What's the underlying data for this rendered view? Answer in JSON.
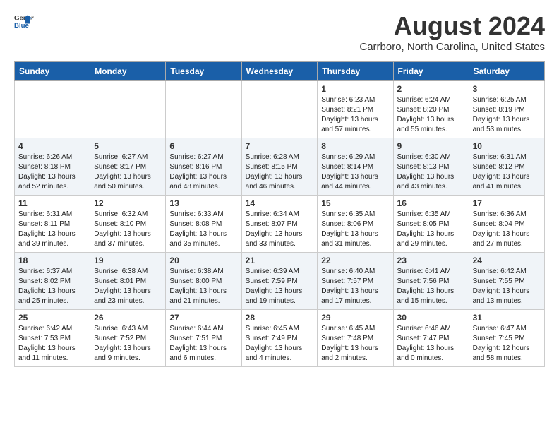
{
  "header": {
    "logo_line1": "General",
    "logo_line2": "Blue",
    "title": "August 2024",
    "subtitle": "Carrboro, North Carolina, United States"
  },
  "weekdays": [
    "Sunday",
    "Monday",
    "Tuesday",
    "Wednesday",
    "Thursday",
    "Friday",
    "Saturday"
  ],
  "weeks": [
    [
      {
        "day": "",
        "info": ""
      },
      {
        "day": "",
        "info": ""
      },
      {
        "day": "",
        "info": ""
      },
      {
        "day": "",
        "info": ""
      },
      {
        "day": "1",
        "info": "Sunrise: 6:23 AM\nSunset: 8:21 PM\nDaylight: 13 hours\nand 57 minutes."
      },
      {
        "day": "2",
        "info": "Sunrise: 6:24 AM\nSunset: 8:20 PM\nDaylight: 13 hours\nand 55 minutes."
      },
      {
        "day": "3",
        "info": "Sunrise: 6:25 AM\nSunset: 8:19 PM\nDaylight: 13 hours\nand 53 minutes."
      }
    ],
    [
      {
        "day": "4",
        "info": "Sunrise: 6:26 AM\nSunset: 8:18 PM\nDaylight: 13 hours\nand 52 minutes."
      },
      {
        "day": "5",
        "info": "Sunrise: 6:27 AM\nSunset: 8:17 PM\nDaylight: 13 hours\nand 50 minutes."
      },
      {
        "day": "6",
        "info": "Sunrise: 6:27 AM\nSunset: 8:16 PM\nDaylight: 13 hours\nand 48 minutes."
      },
      {
        "day": "7",
        "info": "Sunrise: 6:28 AM\nSunset: 8:15 PM\nDaylight: 13 hours\nand 46 minutes."
      },
      {
        "day": "8",
        "info": "Sunrise: 6:29 AM\nSunset: 8:14 PM\nDaylight: 13 hours\nand 44 minutes."
      },
      {
        "day": "9",
        "info": "Sunrise: 6:30 AM\nSunset: 8:13 PM\nDaylight: 13 hours\nand 43 minutes."
      },
      {
        "day": "10",
        "info": "Sunrise: 6:31 AM\nSunset: 8:12 PM\nDaylight: 13 hours\nand 41 minutes."
      }
    ],
    [
      {
        "day": "11",
        "info": "Sunrise: 6:31 AM\nSunset: 8:11 PM\nDaylight: 13 hours\nand 39 minutes."
      },
      {
        "day": "12",
        "info": "Sunrise: 6:32 AM\nSunset: 8:10 PM\nDaylight: 13 hours\nand 37 minutes."
      },
      {
        "day": "13",
        "info": "Sunrise: 6:33 AM\nSunset: 8:08 PM\nDaylight: 13 hours\nand 35 minutes."
      },
      {
        "day": "14",
        "info": "Sunrise: 6:34 AM\nSunset: 8:07 PM\nDaylight: 13 hours\nand 33 minutes."
      },
      {
        "day": "15",
        "info": "Sunrise: 6:35 AM\nSunset: 8:06 PM\nDaylight: 13 hours\nand 31 minutes."
      },
      {
        "day": "16",
        "info": "Sunrise: 6:35 AM\nSunset: 8:05 PM\nDaylight: 13 hours\nand 29 minutes."
      },
      {
        "day": "17",
        "info": "Sunrise: 6:36 AM\nSunset: 8:04 PM\nDaylight: 13 hours\nand 27 minutes."
      }
    ],
    [
      {
        "day": "18",
        "info": "Sunrise: 6:37 AM\nSunset: 8:02 PM\nDaylight: 13 hours\nand 25 minutes."
      },
      {
        "day": "19",
        "info": "Sunrise: 6:38 AM\nSunset: 8:01 PM\nDaylight: 13 hours\nand 23 minutes."
      },
      {
        "day": "20",
        "info": "Sunrise: 6:38 AM\nSunset: 8:00 PM\nDaylight: 13 hours\nand 21 minutes."
      },
      {
        "day": "21",
        "info": "Sunrise: 6:39 AM\nSunset: 7:59 PM\nDaylight: 13 hours\nand 19 minutes."
      },
      {
        "day": "22",
        "info": "Sunrise: 6:40 AM\nSunset: 7:57 PM\nDaylight: 13 hours\nand 17 minutes."
      },
      {
        "day": "23",
        "info": "Sunrise: 6:41 AM\nSunset: 7:56 PM\nDaylight: 13 hours\nand 15 minutes."
      },
      {
        "day": "24",
        "info": "Sunrise: 6:42 AM\nSunset: 7:55 PM\nDaylight: 13 hours\nand 13 minutes."
      }
    ],
    [
      {
        "day": "25",
        "info": "Sunrise: 6:42 AM\nSunset: 7:53 PM\nDaylight: 13 hours\nand 11 minutes."
      },
      {
        "day": "26",
        "info": "Sunrise: 6:43 AM\nSunset: 7:52 PM\nDaylight: 13 hours\nand 9 minutes."
      },
      {
        "day": "27",
        "info": "Sunrise: 6:44 AM\nSunset: 7:51 PM\nDaylight: 13 hours\nand 6 minutes."
      },
      {
        "day": "28",
        "info": "Sunrise: 6:45 AM\nSunset: 7:49 PM\nDaylight: 13 hours\nand 4 minutes."
      },
      {
        "day": "29",
        "info": "Sunrise: 6:45 AM\nSunset: 7:48 PM\nDaylight: 13 hours\nand 2 minutes."
      },
      {
        "day": "30",
        "info": "Sunrise: 6:46 AM\nSunset: 7:47 PM\nDaylight: 13 hours\nand 0 minutes."
      },
      {
        "day": "31",
        "info": "Sunrise: 6:47 AM\nSunset: 7:45 PM\nDaylight: 12 hours\nand 58 minutes."
      }
    ]
  ]
}
